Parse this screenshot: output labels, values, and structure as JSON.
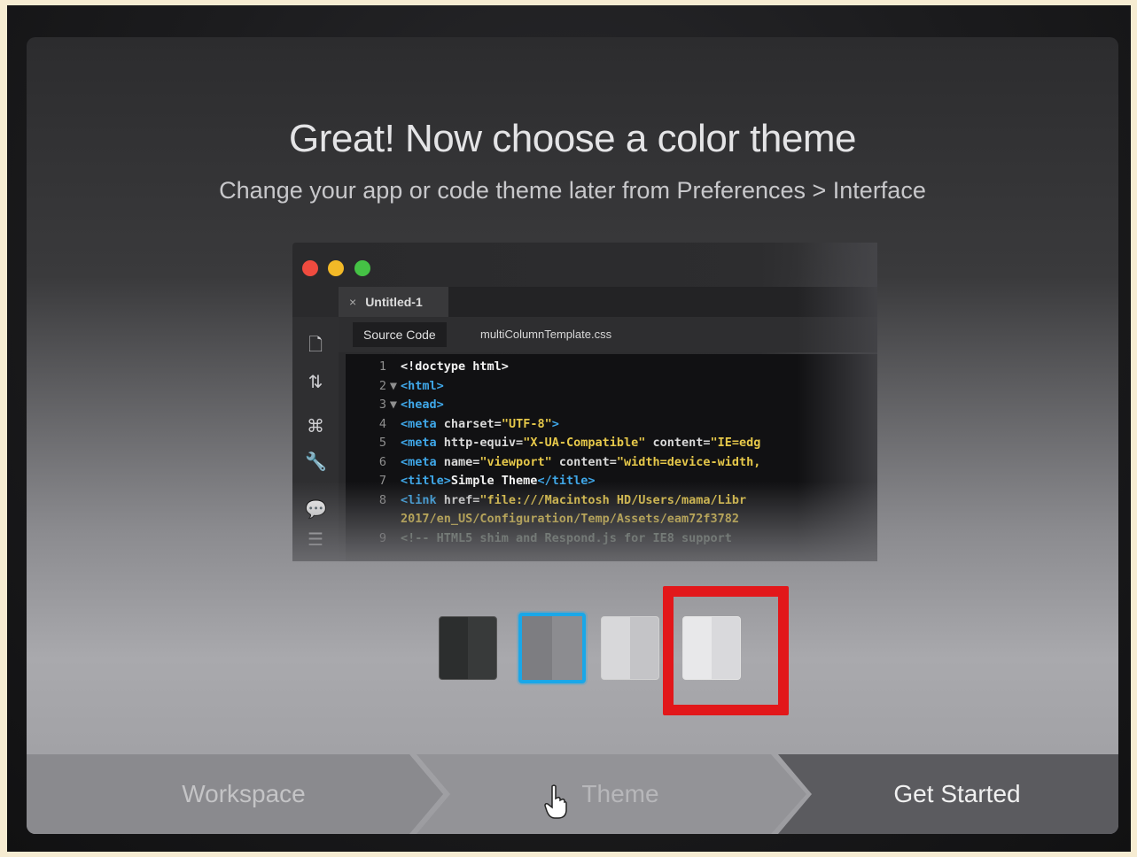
{
  "dialog": {
    "title": "Great! Now choose a color theme",
    "subtitle": "Change your app or code theme later from Preferences > Interface"
  },
  "editor": {
    "window_buttons": [
      "close",
      "minimize",
      "zoom"
    ],
    "doc_tab": {
      "close_glyph": "×",
      "label": "Untitled-1"
    },
    "source_tab_label": "Source Code",
    "related_file": "multiColumnTemplate.css",
    "side_icons": [
      "file-icon",
      "sort-icon",
      "tree-icon",
      "wrench-icon",
      "comment-icon",
      "format-icon"
    ],
    "code_lines": [
      {
        "n": "1",
        "fold": "",
        "parts": [
          [
            "txt",
            "<!doctype html>"
          ]
        ]
      },
      {
        "n": "2",
        "fold": "▼",
        "parts": [
          [
            "tag",
            "<html>"
          ]
        ]
      },
      {
        "n": "3",
        "fold": "▼",
        "parts": [
          [
            "tag",
            "<head>"
          ]
        ]
      },
      {
        "n": "4",
        "fold": "",
        "parts": [
          [
            "tag",
            "<meta "
          ],
          [
            "attr",
            "charset="
          ],
          [
            "str",
            "\"UTF-8\""
          ],
          [
            "tag",
            ">"
          ]
        ]
      },
      {
        "n": "5",
        "fold": "",
        "parts": [
          [
            "tag",
            "<meta "
          ],
          [
            "attr",
            "http-equiv="
          ],
          [
            "str",
            "\"X-UA-Compatible\""
          ],
          [
            "attr",
            " content="
          ],
          [
            "str",
            "\"IE=edg"
          ]
        ]
      },
      {
        "n": "6",
        "fold": "",
        "parts": [
          [
            "tag",
            "<meta "
          ],
          [
            "attr",
            "name="
          ],
          [
            "str",
            "\"viewport\""
          ],
          [
            "attr",
            " content="
          ],
          [
            "str",
            "\"width=device-width,"
          ]
        ]
      },
      {
        "n": "7",
        "fold": "",
        "parts": [
          [
            "tag",
            "<title>"
          ],
          [
            "txt",
            "Simple Theme"
          ],
          [
            "tag",
            "</title>"
          ]
        ]
      },
      {
        "n": "8",
        "fold": "",
        "parts": [
          [
            "tag",
            "<link "
          ],
          [
            "attr",
            "href="
          ],
          [
            "str",
            "\"file:///Macintosh HD/Users/mama/Libr"
          ]
        ]
      },
      {
        "n": "",
        "fold": "",
        "parts": [
          [
            "str",
            "2017/en_US/Configuration/Temp/Assets/eam72f3782"
          ]
        ]
      },
      {
        "n": "9",
        "fold": "",
        "parts": [
          [
            "cmt",
            "<!-- HTML5 shim and Respond.js for IE8 support"
          ]
        ]
      }
    ]
  },
  "themes": [
    {
      "name": "dark",
      "selected": false
    },
    {
      "name": "medium",
      "selected": true
    },
    {
      "name": "light",
      "selected": false
    },
    {
      "name": "bright",
      "selected": false
    }
  ],
  "steps": {
    "workspace": "Workspace",
    "theme": "Theme",
    "get_started": "Get Started"
  },
  "colors": {
    "selection_outline": "#1aa7e8",
    "annotation_red": "#e2171a",
    "traffic_red": "#ef4b3f",
    "traffic_yellow": "#f2b927",
    "traffic_green": "#45c245"
  }
}
